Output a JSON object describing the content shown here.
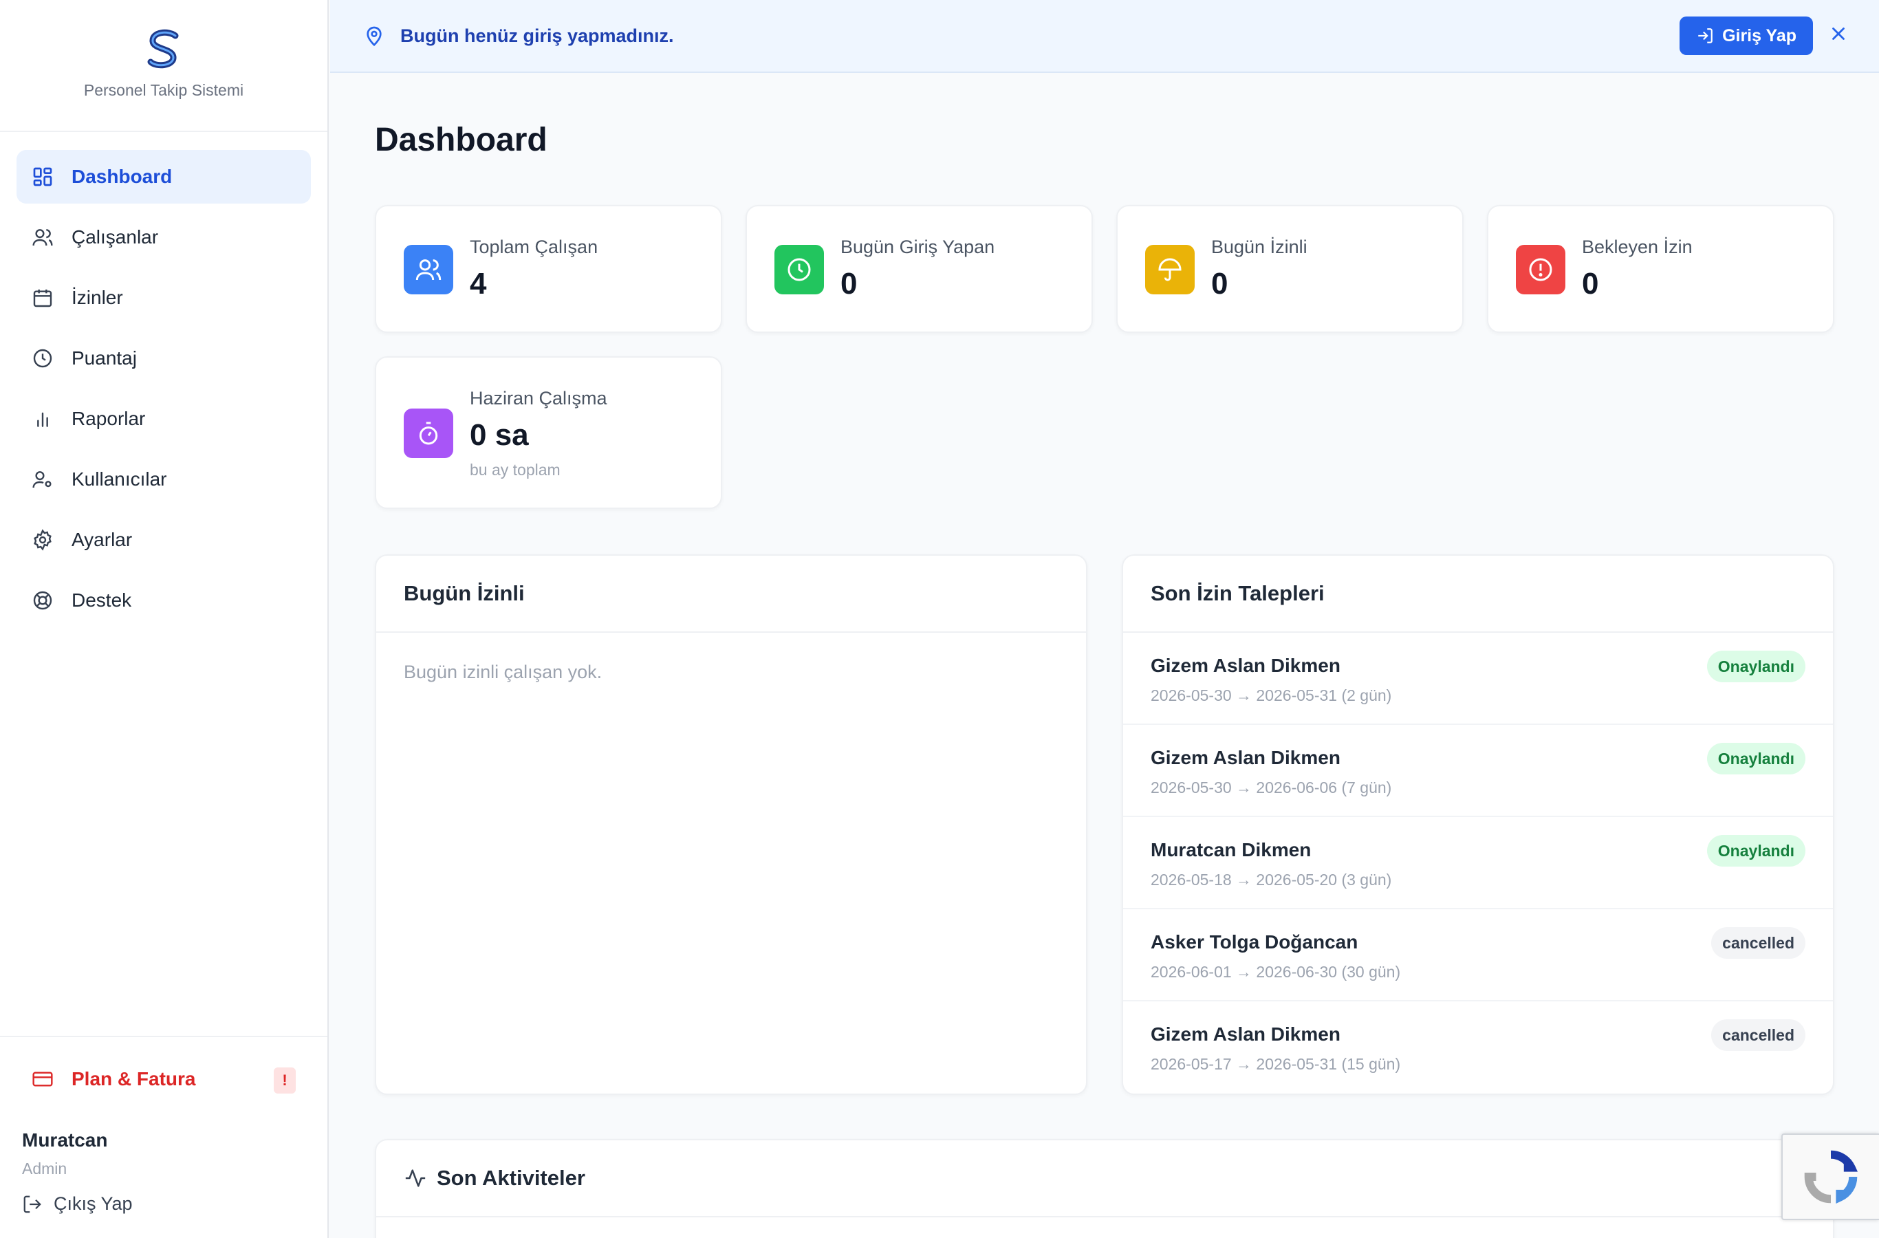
{
  "brand": {
    "subtitle": "Personel Takip Sistemi"
  },
  "sidebar": {
    "items": [
      {
        "label": "Dashboard",
        "icon": "dashboard-icon",
        "active": true
      },
      {
        "label": "Çalışanlar",
        "icon": "users-icon"
      },
      {
        "label": "İzinler",
        "icon": "calendar-icon"
      },
      {
        "label": "Puantaj",
        "icon": "clock-icon"
      },
      {
        "label": "Raporlar",
        "icon": "bar-chart-icon"
      },
      {
        "label": "Kullanıcılar",
        "icon": "user-settings-icon"
      },
      {
        "label": "Ayarlar",
        "icon": "gear-icon"
      },
      {
        "label": "Destek",
        "icon": "lifebuoy-icon"
      }
    ],
    "plan": {
      "label": "Plan & Fatura",
      "badge": "!"
    },
    "user": {
      "name": "Muratcan",
      "role": "Admin"
    },
    "logout_label": "Çıkış Yap"
  },
  "banner": {
    "text": "Bugün henüz giriş yapmadınız.",
    "button_label": "Giriş Yap"
  },
  "page": {
    "title": "Dashboard"
  },
  "stats": [
    {
      "label": "Toplam Çalışan",
      "value": "4",
      "color": "#3b82f6",
      "icon": "users-icon"
    },
    {
      "label": "Bugün Giriş Yapan",
      "value": "0",
      "color": "#22c55e",
      "icon": "clock-icon"
    },
    {
      "label": "Bugün İzinli",
      "value": "0",
      "color": "#eab308",
      "icon": "umbrella-icon"
    },
    {
      "label": "Bekleyen İzin",
      "value": "0",
      "color": "#ef4444",
      "icon": "alert-icon"
    },
    {
      "label": "Haziran Çalışma",
      "value": "0 sa",
      "sub": "bu ay toplam",
      "color": "#a855f7",
      "icon": "stopwatch-icon"
    }
  ],
  "today_leave": {
    "title": "Bugün İzinli",
    "empty": "Bugün izinli çalışan yok."
  },
  "recent_requests": {
    "title": "Son İzin Talepleri",
    "items": [
      {
        "name": "Gizem Aslan Dikmen",
        "dates": "2026-05-30 → 2026-05-31 (2 gün)",
        "status": "Onaylandı",
        "kind": "approved"
      },
      {
        "name": "Gizem Aslan Dikmen",
        "dates": "2026-05-30 → 2026-06-06 (7 gün)",
        "status": "Onaylandı",
        "kind": "approved"
      },
      {
        "name": "Muratcan Dikmen",
        "dates": "2026-05-18 → 2026-05-20 (3 gün)",
        "status": "Onaylandı",
        "kind": "approved"
      },
      {
        "name": "Asker Tolga Doğancan",
        "dates": "2026-06-01 → 2026-06-30 (30 gün)",
        "status": "cancelled",
        "kind": "cancelled"
      },
      {
        "name": "Gizem Aslan Dikmen",
        "dates": "2026-05-17 → 2026-05-31 (15 gün)",
        "status": "cancelled",
        "kind": "cancelled"
      }
    ]
  },
  "activities": {
    "title": "Son Aktiviteler"
  }
}
